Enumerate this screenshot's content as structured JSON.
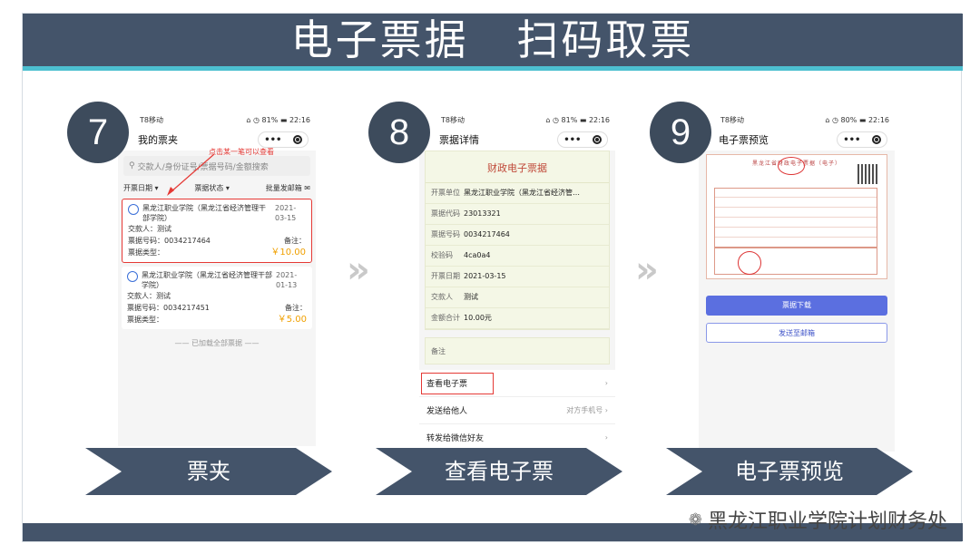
{
  "header": {
    "title": "电子票据   扫码取票"
  },
  "steps": [
    "7",
    "8",
    "9"
  ],
  "phone1": {
    "status_left": "T8移动",
    "status_right": "⌂ ◷ 81% ▬ 22:16",
    "nav_title": "我的票夹",
    "search_placeholder": "交款人/身份证号/票据号码/金额搜索",
    "filters": [
      "开票日期 ▾",
      "票据状态 ▾",
      "批量发邮箱 ✉"
    ],
    "annotation": "点击某一笔可以查看",
    "cards": [
      {
        "payer_label": "黑龙江职业学院（黑龙江省经济管理干部学院）",
        "date": "2021-03-15",
        "payer": "交款人：测试",
        "number": "票据号码：0034217464",
        "remark": "备注：",
        "type": "票据类型：",
        "amount": "￥10.00"
      },
      {
        "payer_label": "黑龙江职业学院（黑龙江省经济管理干部学院）",
        "date": "2021-01-13",
        "payer": "交款人：测试",
        "number": "票据号码：0034217451",
        "remark": "备注：",
        "type": "票据类型：",
        "amount": "￥5.00"
      }
    ],
    "loaded": "—— 已加载全部票据 ——"
  },
  "phone2": {
    "status_left": "T8移动",
    "status_right": "⌂ ◷ 81% ▬ 22:16",
    "nav_title": "票据详情",
    "receipt_title": "财政电子票据",
    "rows": [
      {
        "label": "开票单位",
        "value": "黑龙江职业学院（黑龙江省经济管…"
      },
      {
        "label": "票据代码",
        "value": "23013321"
      },
      {
        "label": "票据号码",
        "value": "0034217464"
      },
      {
        "label": "校验码",
        "value": "4ca0a4"
      },
      {
        "label": "开票日期",
        "value": "2021-03-15"
      },
      {
        "label": "交款人",
        "value": "测试"
      },
      {
        "label": "金额合计",
        "value": "10.00元"
      }
    ],
    "remark_label": "备注",
    "menu": [
      {
        "label": "查看电子票",
        "right": "›"
      },
      {
        "label": "发送给他人",
        "right": "对方手机号 ›"
      },
      {
        "label": "转发给微信好友",
        "right": "›"
      }
    ]
  },
  "phone3": {
    "status_left": "T8移动",
    "status_right": "⌂ ◷ 80% ▬ 22:16",
    "nav_title": "电子票预览",
    "invoice_title": "黑龙江省财政电子票据（电子）",
    "download_label": "票据下载",
    "send_mail_label": "发送至邮箱"
  },
  "banners": [
    "票夹",
    "查看电子票",
    "电子票预览"
  ],
  "watermark": "黑龙江职业学院计划财务处",
  "colors": {
    "header": "#44546a",
    "accent_line": "#4dbfd0",
    "circle": "#3d4b5c",
    "highlight": "#e53935",
    "amount": "#f0a000",
    "button": "#5b6fe0"
  }
}
